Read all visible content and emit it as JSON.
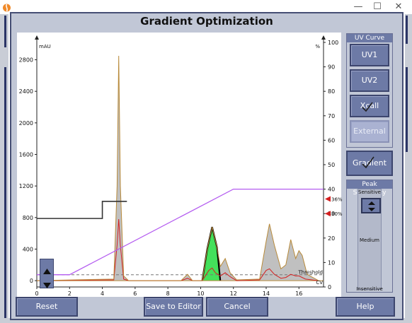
{
  "window": {
    "minimize": "—",
    "maximize": "☐",
    "close": "✕"
  },
  "dialog": {
    "title": "Gradient Optimization"
  },
  "uv_curve": {
    "header": "UV Curve",
    "buttons": [
      "UV1",
      "UV2",
      "Xcall",
      "External"
    ]
  },
  "gradient_button": "Gradient",
  "peak_sensitivity": {
    "header": "Peak Sensitivity",
    "levels": [
      "Sensitive",
      "Medium",
      "Insensitive"
    ],
    "value": 0.1
  },
  "bottom_buttons": {
    "reset": "Reset",
    "save": "Save to Editor",
    "cancel": "Cancel",
    "help": "Help"
  },
  "chart_data": {
    "type": "line",
    "left_axis_label": "mAU",
    "right_axis_label": "%",
    "x_ticks": [
      "0",
      "2",
      "4",
      "6",
      "8",
      "10",
      "12",
      "14",
      "16"
    ],
    "y_ticks_left": [
      "0",
      "400",
      "800",
      "1200",
      "1600",
      "2000",
      "2400",
      "2800"
    ],
    "y_ticks_right": [
      "0",
      "10",
      "20",
      "30",
      "40",
      "50",
      "60",
      "70",
      "80",
      "90",
      "100"
    ],
    "xlim": [
      0,
      17.5
    ],
    "ylim_left": [
      -80,
      3020
    ],
    "ylim_right": [
      0,
      100
    ],
    "threshold_label": "Threshold",
    "cv_label": "CV",
    "markers": [
      {
        "label": "36%",
        "value": 36
      },
      {
        "label": "30%",
        "value": 30
      }
    ],
    "gradient_percent": {
      "name": "gradient",
      "color": "#b45cf0",
      "x": [
        0,
        2,
        12,
        17.5
      ],
      "y": [
        5,
        5,
        40,
        40
      ]
    },
    "flow_step": {
      "color": "#333333",
      "x": [
        0,
        4,
        4,
        5.5
      ],
      "y": [
        28,
        28,
        35,
        35
      ]
    },
    "threshold_value": 5,
    "uv1_series": {
      "color": "#b88a3a",
      "x": [
        0,
        4.7,
        4.9,
        5.0,
        5.1,
        5.3,
        5.6,
        8.8,
        9.2,
        9.5,
        10.1,
        10.4,
        10.7,
        11.0,
        11.2,
        11.5,
        11.8,
        12.2,
        13.6,
        14.0,
        14.2,
        14.5,
        14.9,
        15.2,
        15.5,
        15.8,
        16.0,
        16.2,
        16.5,
        17.2
      ],
      "y": [
        0,
        20,
        1200,
        2850,
        1200,
        60,
        0,
        0,
        80,
        0,
        0,
        400,
        680,
        420,
        180,
        280,
        100,
        10,
        20,
        500,
        720,
        450,
        150,
        200,
        520,
        280,
        380,
        320,
        80,
        0
      ]
    },
    "uv2_series": {
      "color": "#d42020",
      "x": [
        0,
        4.7,
        4.9,
        5.0,
        5.1,
        5.3,
        5.6,
        8.8,
        9.2,
        9.5,
        10.1,
        10.5,
        10.7,
        10.9,
        11.2,
        11.5,
        11.8,
        12.2,
        13.6,
        14.0,
        14.2,
        14.5,
        14.9,
        15.2,
        15.5,
        15.8,
        16.0,
        16.4,
        17.2
      ],
      "y": [
        0,
        10,
        450,
        780,
        450,
        20,
        0,
        0,
        30,
        0,
        0,
        130,
        160,
        100,
        60,
        100,
        50,
        0,
        10,
        130,
        150,
        80,
        30,
        40,
        80,
        60,
        60,
        20,
        0
      ]
    },
    "selected_peak": {
      "color": "#44e05a",
      "x": [
        10.1,
        10.4,
        10.7,
        11.0,
        11.2
      ],
      "y": [
        0,
        400,
        680,
        420,
        0
      ]
    }
  }
}
